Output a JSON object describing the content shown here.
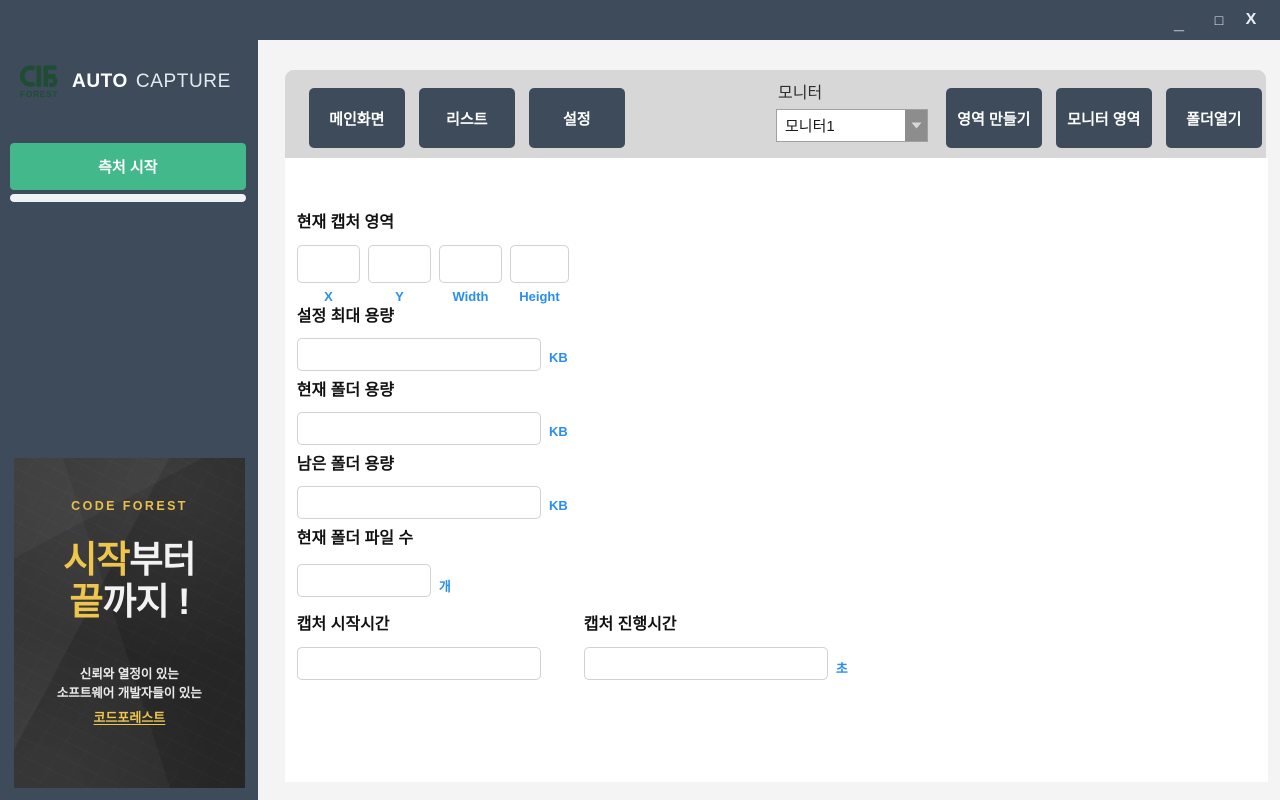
{
  "window": {
    "minimize_label": "_",
    "maximize_label": "□",
    "close_label": "X"
  },
  "sidebar": {
    "brand": {
      "auto": "AUTO",
      "capture": "CAPTURE",
      "logo_caption": "FOREST"
    },
    "capture_button_label": "측처 시작",
    "capture_button_color": "#43b98b",
    "progress_value": 0,
    "ad": {
      "kicker": "CODE FOREST",
      "headline_gold_1": "시작",
      "headline_white_1": "부터",
      "headline_gold_2": "끝",
      "headline_white_2": "까지 !",
      "body_line1": "신뢰와 열정이 있는",
      "body_line2": "소프트웨어 개발자들이 있는",
      "brand": "코드포레스트",
      "gold_color": "#eec54d"
    }
  },
  "toolbar": {
    "main_label": "메인화면",
    "list_label": "리스트",
    "config_label": "설정",
    "monitor_label": "모니터",
    "monitor_selected": "모니터1",
    "monitor_options": [
      "모니터1"
    ],
    "make_area_label": "영역 만들기",
    "monitor_area_label": "모니터 영역",
    "open_folder_label": "폴더열기"
  },
  "form": {
    "capture_area": {
      "title": "현재 캡처 영역",
      "x_label": "X",
      "x_value": "",
      "y_label": "Y",
      "y_value": "",
      "width_label": "Width",
      "width_value": "",
      "height_label": "Height",
      "height_value": ""
    },
    "max_size": {
      "title": "설정 최대 용량",
      "value": "",
      "unit": "KB"
    },
    "current_folder_size": {
      "title": "현재 폴더 용량",
      "value": "",
      "unit": "KB"
    },
    "remaining_folder_size": {
      "title": "남은 폴더 용량",
      "value": "",
      "unit": "KB"
    },
    "file_count": {
      "title": "현재 폴더 파일 수",
      "value": "",
      "unit": "개"
    },
    "start_time": {
      "title": "캡처 시작시간",
      "value": ""
    },
    "elapsed_time": {
      "title": "캡처 진행시간",
      "value": "",
      "unit": "초"
    }
  }
}
